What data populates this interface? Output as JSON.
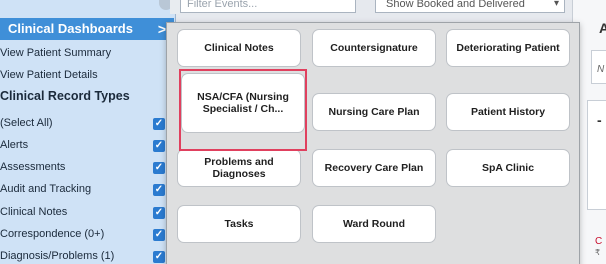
{
  "sidebar": {
    "header": "Clinical Dashboards",
    "header_chevron": ">",
    "links": [
      "View Patient Summary",
      "View Patient Details"
    ],
    "section_title": "Clinical Record Types",
    "items": [
      {
        "label": "(Select All)",
        "checked": true
      },
      {
        "label": "Alerts",
        "checked": true
      },
      {
        "label": "Assessments",
        "checked": true
      },
      {
        "label": "Audit and Tracking",
        "checked": true
      },
      {
        "label": "Clinical Notes",
        "checked": true
      },
      {
        "label": "Correspondence (0+)",
        "checked": true
      },
      {
        "label": "Diagnosis/Problems (1)",
        "checked": true
      }
    ]
  },
  "filter": {
    "placeholder": "Filter Events...",
    "select_value": "Show Booked and Delivered"
  },
  "right_panel": {
    "heading": "A",
    "field": "N",
    "dash": "-",
    "red_text": "C"
  },
  "popup": {
    "tiles": [
      "Clinical Notes",
      "Countersignature",
      "Deteriorating Patient",
      "NSA/CFA (Nursing Specialist / Ch...",
      "Nursing Care Plan",
      "Patient History",
      "Problems and Diagnoses",
      "Recovery Care Plan",
      "SpA Clinic",
      "Tasks",
      "Ward Round"
    ],
    "highlighted": "NSA/CFA (Nursing Specialist / Ch..."
  },
  "colors": {
    "sidebar_bg": "#cfe2f6",
    "header_bg": "#3f8fd8",
    "checkbox": "#2b7bd0",
    "highlight": "#e0405e"
  }
}
